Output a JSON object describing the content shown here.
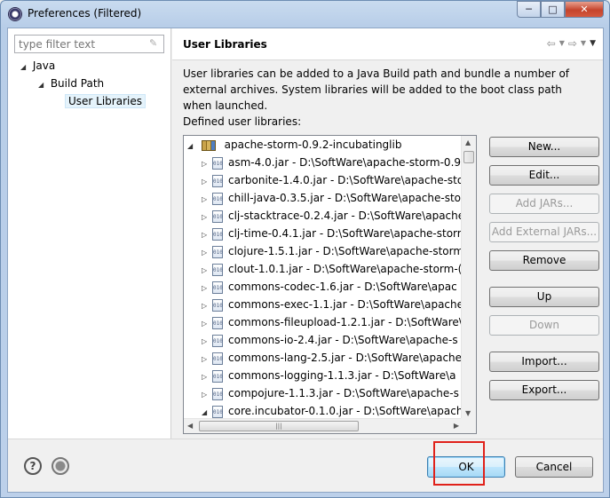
{
  "window": {
    "title": "Preferences (Filtered)",
    "controls": {
      "minimize": "─",
      "maximize": "□",
      "close": "✕"
    }
  },
  "sidebar": {
    "filter_placeholder": "type filter text",
    "tree": [
      {
        "label": "Java",
        "level": 0
      },
      {
        "label": "Build Path",
        "level": 1
      },
      {
        "label": "User Libraries",
        "level": 2,
        "selected": true
      }
    ]
  },
  "page": {
    "title": "User Libraries",
    "description": "User libraries can be added to a Java Build path and bundle a number of external archives. System libraries will be added to the boot class path when launched.",
    "defined_label": "Defined user libraries:"
  },
  "libraries": {
    "root": "apache-storm-0.9.2-incubatinglib",
    "jars": [
      "asm-4.0.jar - D:\\SoftWare\\apache-storm-0.9",
      "carbonite-1.4.0.jar - D:\\SoftWare\\apache-sto",
      "chill-java-0.3.5.jar - D:\\SoftWare\\apache-sto",
      "clj-stacktrace-0.2.4.jar - D:\\SoftWare\\apache",
      "clj-time-0.4.1.jar - D:\\SoftWare\\apache-storr",
      "clojure-1.5.1.jar - D:\\SoftWare\\apache-storm",
      "clout-1.0.1.jar - D:\\SoftWare\\apache-storm-(",
      "commons-codec-1.6.jar - D:\\SoftWare\\apac",
      "commons-exec-1.1.jar - D:\\SoftWare\\apache",
      "commons-fileupload-1.2.1.jar - D:\\SoftWare\\",
      "commons-io-2.4.jar - D:\\SoftWare\\apache-s",
      "commons-lang-2.5.jar - D:\\SoftWare\\apache",
      "commons-logging-1.1.3.jar - D:\\SoftWare\\a",
      "compojure-1.1.3.jar - D:\\SoftWare\\apache-s",
      "core.incubator-0.1.0.jar - D:\\SoftWare\\apach"
    ],
    "jar_icon_text": "010"
  },
  "buttons": {
    "new": "New...",
    "edit": "Edit...",
    "add_jars": "Add JARs...",
    "add_external_jars": "Add External JARs...",
    "remove": "Remove",
    "up": "Up",
    "down": "Down",
    "import": "Import...",
    "export": "Export..."
  },
  "footer": {
    "help": "?",
    "ok": "OK",
    "cancel": "Cancel"
  },
  "colors": {
    "highlight_border": "#e0211a",
    "selection_bg": "#e5f3fb"
  }
}
